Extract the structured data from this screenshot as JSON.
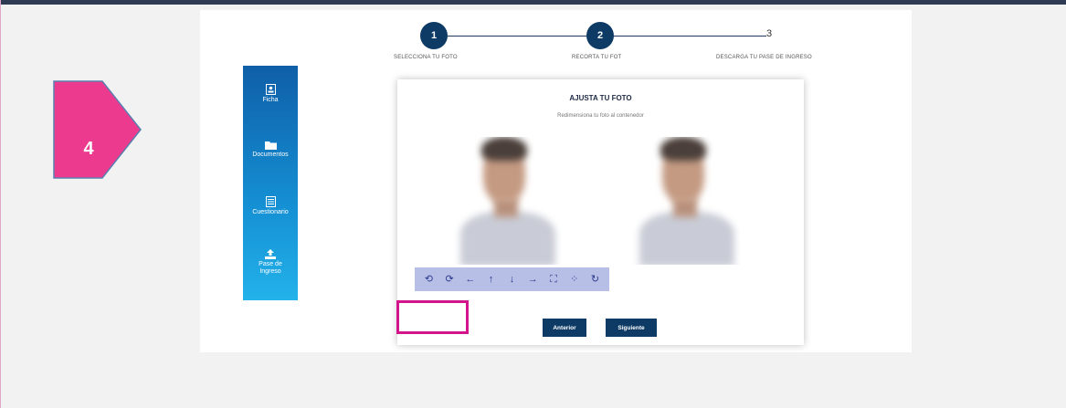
{
  "marker": {
    "number": "4",
    "color": "#ec3a8f"
  },
  "stepper": {
    "steps": [
      {
        "number": "1",
        "label": "SELECCIONA TU FOTO",
        "active": true
      },
      {
        "number": "2",
        "label": "RECORTA TU FOT",
        "active": true
      },
      {
        "number": "3",
        "label": "DESCARGA TU PASE DE INGRESO",
        "active": false
      }
    ]
  },
  "sidebar": {
    "items": [
      {
        "label": "Ficha",
        "icon": "id-card-icon"
      },
      {
        "label": "Documentos",
        "icon": "folder-icon"
      },
      {
        "label": "Cuestionario",
        "icon": "list-icon"
      },
      {
        "label": "Pase de Ingreso",
        "icon": "upload-icon"
      }
    ]
  },
  "card": {
    "title": "AJUSTA TU FOTO",
    "subtitle": "Redimensiona tu foto al contenedor"
  },
  "toolbar": {
    "tools": [
      {
        "glyph": "⟲",
        "name": "rotate-left-icon"
      },
      {
        "glyph": "⟳",
        "name": "rotate-right-icon"
      },
      {
        "glyph": "←",
        "name": "arrow-left-icon"
      },
      {
        "glyph": "↑",
        "name": "arrow-up-icon"
      },
      {
        "glyph": "↓",
        "name": "arrow-down-icon"
      },
      {
        "glyph": "→",
        "name": "arrow-right-icon"
      },
      {
        "glyph": "⛶",
        "name": "zoom-in-icon"
      },
      {
        "glyph": "⁘",
        "name": "zoom-out-icon"
      },
      {
        "glyph": "↻",
        "name": "reset-icon"
      }
    ]
  },
  "buttons": {
    "previous": "Anterior",
    "next": "Siguiente"
  },
  "colors": {
    "primary": "#0d3b66",
    "highlight": "#d4148a",
    "toolbar": "#b8bfe6"
  }
}
